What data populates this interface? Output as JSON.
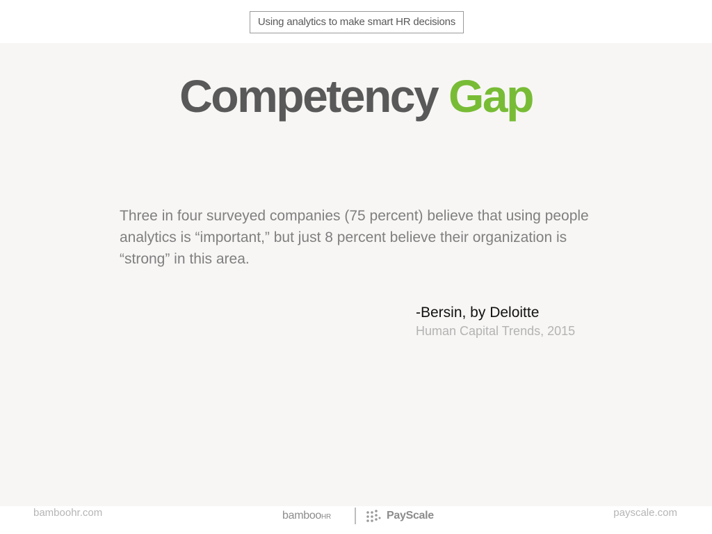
{
  "header": {
    "tagline": "Using analytics to make smart HR decisions"
  },
  "slide": {
    "title_word1": "Competency",
    "title_word2": "Gap",
    "quote": "Three in four surveyed companies (75 percent) believe that using people analytics is “important,” but just 8 percent believe their organization is “strong” in this area.",
    "author": "-Bersin, by Deloitte",
    "source": "Human Capital Trends, 2015"
  },
  "footer": {
    "left_link": "bamboohr.com",
    "right_link": "payscale.com",
    "brand_bamboo": "bamboo",
    "brand_bamboo_suffix": "HR",
    "brand_payscale": "PayScale"
  },
  "colors": {
    "title_gray": "#595959",
    "title_green": "#78bc36",
    "slide_background": "#f7f6f4"
  }
}
